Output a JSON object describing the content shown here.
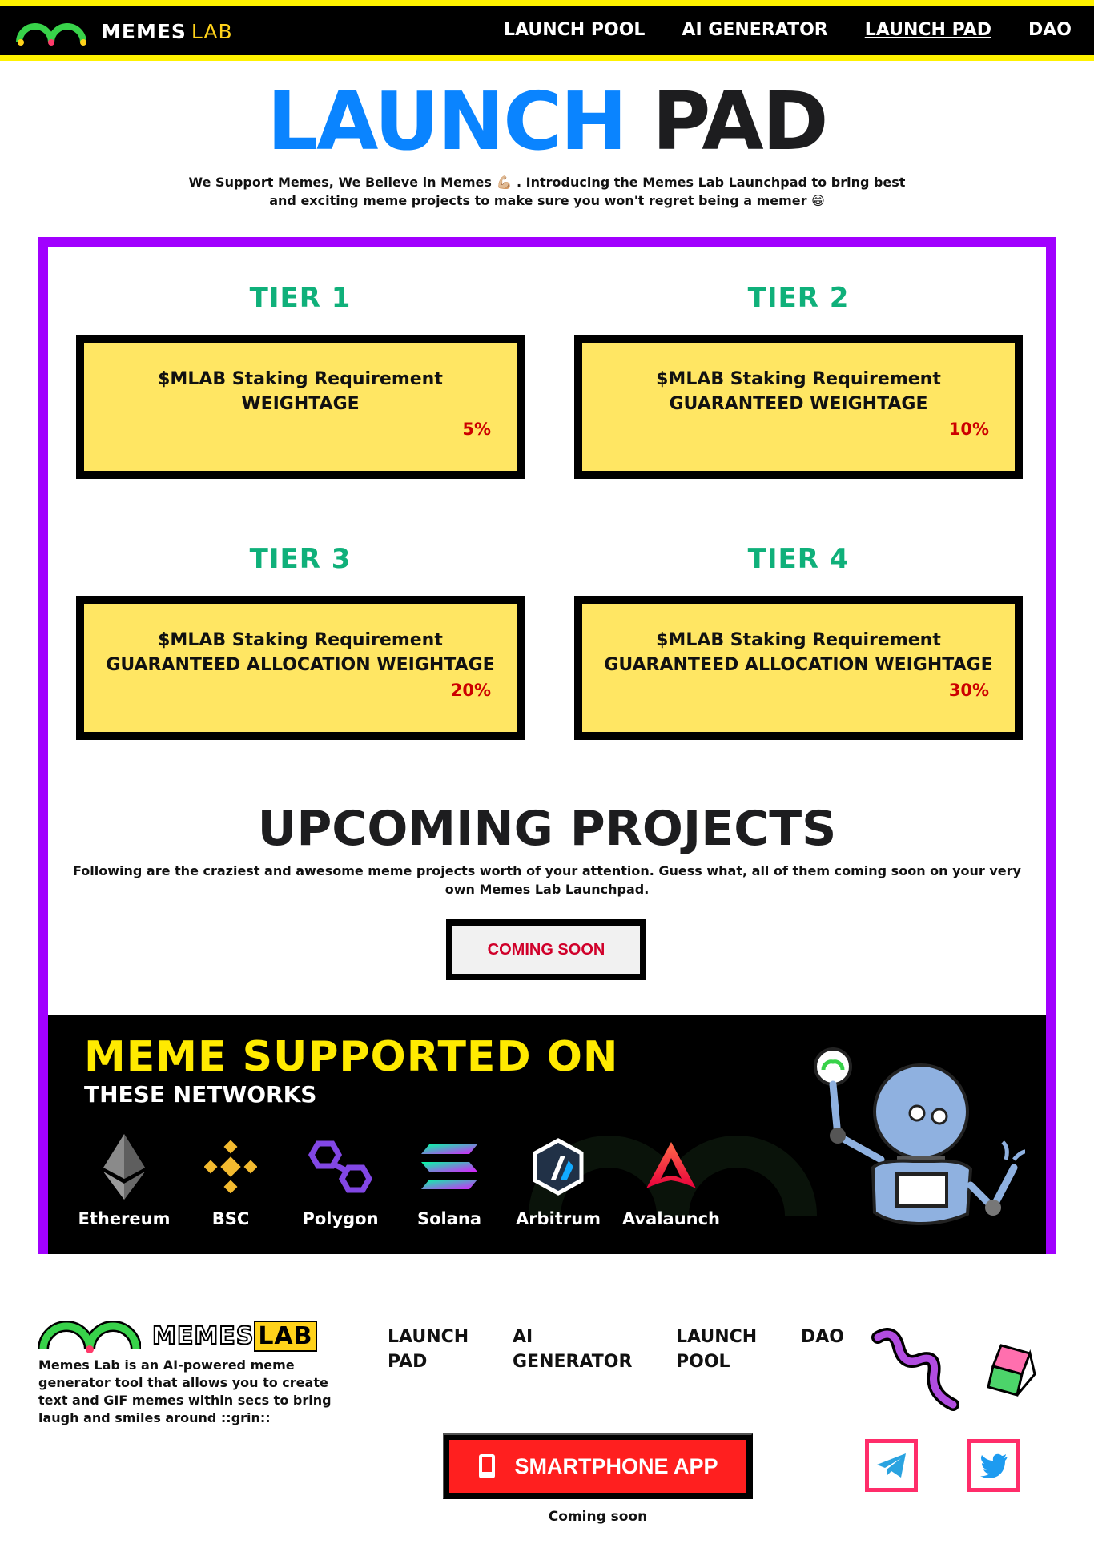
{
  "nav": {
    "brand_main": "MEMES",
    "brand_lab": "LAB",
    "links": [
      {
        "label": "LAUNCH POOL",
        "active": false
      },
      {
        "label": "AI GENERATOR",
        "active": false
      },
      {
        "label": "LAUNCH PAD",
        "active": true
      },
      {
        "label": "DAO",
        "active": false
      }
    ]
  },
  "hero": {
    "title_blue": "LAUNCH",
    "title_dark": "PAD",
    "subtitle": "We Support Memes, We Believe in Memes 💪🏼 . Introducing the Memes Lab Launchpad to bring best and exciting meme projects to make sure you won't regret being a memer 😁"
  },
  "tiers": [
    {
      "title": "TIER 1",
      "line1": "$MLAB Staking Requirement",
      "line2": "WEIGHTAGE",
      "percent": "5%"
    },
    {
      "title": "TIER 2",
      "line1": "$MLAB Staking Requirement",
      "line2": "GUARANTEED WEIGHTAGE",
      "percent": "10%"
    },
    {
      "title": "TIER 3",
      "line1": "$MLAB Staking Requirement",
      "line2": "GUARANTEED ALLOCATION WEIGHTAGE",
      "percent": "20%"
    },
    {
      "title": "TIER 4",
      "line1": "$MLAB Staking Requirement",
      "line2": "GUARANTEED ALLOCATION WEIGHTAGE",
      "percent": "30%"
    }
  ],
  "upcoming": {
    "title": "UPCOMING PROJECTS",
    "subtitle": "Following are the craziest and awesome meme projects worth of your attention. Guess what, all of them coming soon on your very own Memes Lab Launchpad.",
    "button": "COMING SOON"
  },
  "networks": {
    "title": "MEME SUPPORTED ON",
    "subtitle": "THESE NETWORKS",
    "items": [
      {
        "label": "Ethereum",
        "icon": "ethereum-icon"
      },
      {
        "label": "BSC",
        "icon": "bnb-icon"
      },
      {
        "label": "Polygon",
        "icon": "polygon-icon"
      },
      {
        "label": "Solana",
        "icon": "solana-icon"
      },
      {
        "label": "Arbitrum",
        "icon": "arbitrum-icon"
      },
      {
        "label": "Avalaunch",
        "icon": "avalaunch-icon"
      }
    ]
  },
  "footer": {
    "brand_main": "MEMES",
    "brand_lab": "LAB",
    "description": "Memes Lab is an AI-powered meme generator tool that allows you to create text and GIF memes within secs to bring laugh and smiles around ::grin::",
    "links": [
      "LAUNCH PAD",
      "AI GENERATOR",
      "LAUNCH POOL",
      "DAO"
    ],
    "app_button": "SMARTPHONE APP",
    "app_note": "Coming soon",
    "social": [
      "telegram-icon",
      "twitter-icon"
    ]
  },
  "colors": {
    "accent_yellow": "#fff200",
    "hero_blue": "#0a84ff",
    "frame_purple": "#a100ff",
    "tier_green": "#0fb07a",
    "card_yellow": "#ffe663",
    "percent_red": "#cc0000",
    "app_red": "#ff1f1f",
    "social_pink": "#ff2d6a"
  }
}
